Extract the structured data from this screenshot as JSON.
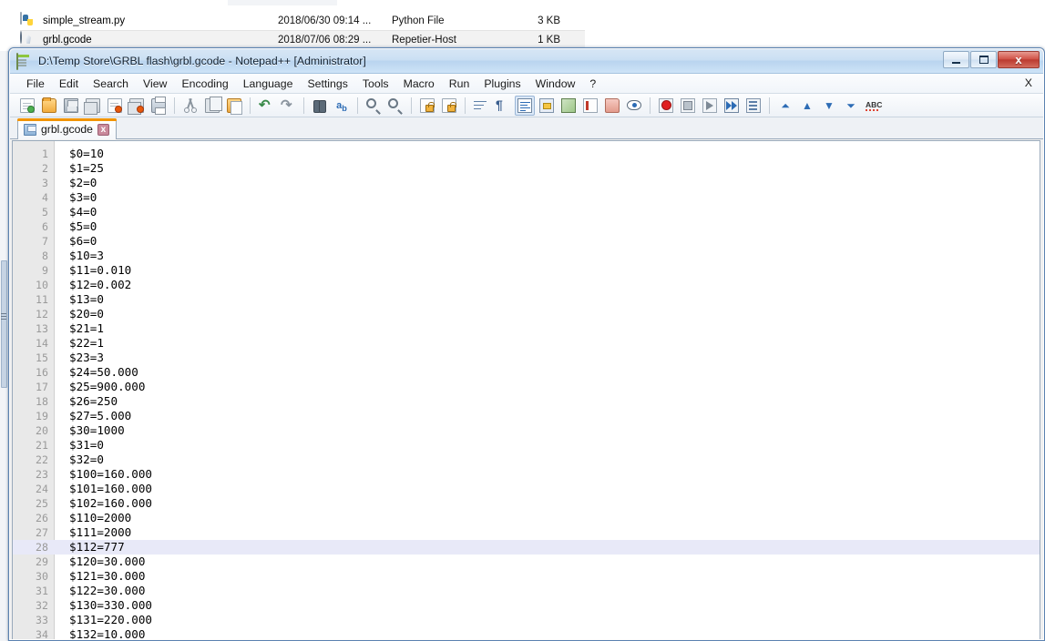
{
  "explorer": {
    "rows": [
      {
        "icon": "python-file-icon",
        "name": "simple_stream.py",
        "date": "2018/06/30 09:14 ...",
        "type": "Python File",
        "size": "3 KB",
        "selected": false
      },
      {
        "icon": "gcode-file-icon",
        "name": "grbl.gcode",
        "date": "2018/07/06 08:29 ...",
        "type": "Repetier-Host",
        "size": "1 KB",
        "selected": true
      }
    ]
  },
  "window": {
    "title": "D:\\Temp Store\\GRBL flash\\grbl.gcode - Notepad++ [Administrator]",
    "app_icon": "notepad-plus-plus-icon",
    "controls": {
      "minimize": "minimize-button",
      "maximize": "maximize-button",
      "close_label": "x"
    },
    "accent_color": "#f29400",
    "titlebar_color": "#cadff3",
    "close_color": "#bb3b30"
  },
  "menubar": {
    "items": [
      "File",
      "Edit",
      "Search",
      "View",
      "Encoding",
      "Language",
      "Settings",
      "Tools",
      "Macro",
      "Run",
      "Plugins",
      "Window",
      "?"
    ],
    "right_label": "X"
  },
  "toolbar": {
    "buttons": [
      "new-file-icon",
      "open-file-icon",
      "save-icon",
      "save-all-icon",
      "close-file-icon",
      "close-all-files-icon",
      "print-icon",
      "cut-icon",
      "copy-icon",
      "paste-icon",
      "undo-icon",
      "redo-icon",
      "find-icon",
      "replace-icon",
      "zoom-in-icon",
      "zoom-out-icon",
      "sync-vertical-scroll-icon",
      "sync-horizontal-scroll-icon",
      "word-wrap-icon",
      "show-all-characters-icon",
      "indent-guide-icon",
      "user-defined-language-icon",
      "show-document-map-icon",
      "function-list-icon",
      "folder-as-workspace-icon",
      "monitoring-icon",
      "start-recording-icon",
      "stop-recording-icon",
      "playback-icon",
      "run-multiple-times-icon",
      "save-macro-icon",
      "collapse-all-icon",
      "collapse-level-icon",
      "expand-level-icon",
      "expand-all-icon",
      "spell-check-icon"
    ]
  },
  "tabs": [
    {
      "label": "grbl.gcode",
      "icon": "saved-file-icon",
      "close": "x",
      "active": true
    }
  ],
  "editor": {
    "current_line": 28,
    "current_line_color": "#e8e9f8",
    "gutter_color": "#e9e9e9",
    "lines": [
      {
        "n": 1,
        "text": "$0=10"
      },
      {
        "n": 2,
        "text": "$1=25"
      },
      {
        "n": 3,
        "text": "$2=0"
      },
      {
        "n": 4,
        "text": "$3=0"
      },
      {
        "n": 5,
        "text": "$4=0"
      },
      {
        "n": 6,
        "text": "$5=0"
      },
      {
        "n": 7,
        "text": "$6=0"
      },
      {
        "n": 8,
        "text": "$10=3"
      },
      {
        "n": 9,
        "text": "$11=0.010"
      },
      {
        "n": 10,
        "text": "$12=0.002"
      },
      {
        "n": 11,
        "text": "$13=0"
      },
      {
        "n": 12,
        "text": "$20=0"
      },
      {
        "n": 13,
        "text": "$21=1"
      },
      {
        "n": 14,
        "text": "$22=1"
      },
      {
        "n": 15,
        "text": "$23=3"
      },
      {
        "n": 16,
        "text": "$24=50.000"
      },
      {
        "n": 17,
        "text": "$25=900.000"
      },
      {
        "n": 18,
        "text": "$26=250"
      },
      {
        "n": 19,
        "text": "$27=5.000"
      },
      {
        "n": 20,
        "text": "$30=1000"
      },
      {
        "n": 21,
        "text": "$31=0"
      },
      {
        "n": 22,
        "text": "$32=0"
      },
      {
        "n": 23,
        "text": "$100=160.000"
      },
      {
        "n": 24,
        "text": "$101=160.000"
      },
      {
        "n": 25,
        "text": "$102=160.000"
      },
      {
        "n": 26,
        "text": "$110=2000"
      },
      {
        "n": 27,
        "text": "$111=2000"
      },
      {
        "n": 28,
        "text": "$112=777"
      },
      {
        "n": 29,
        "text": "$120=30.000"
      },
      {
        "n": 30,
        "text": "$121=30.000"
      },
      {
        "n": 31,
        "text": "$122=30.000"
      },
      {
        "n": 32,
        "text": "$130=330.000"
      },
      {
        "n": 33,
        "text": "$131=220.000"
      },
      {
        "n": 34,
        "text": "$132=10.000"
      }
    ]
  }
}
